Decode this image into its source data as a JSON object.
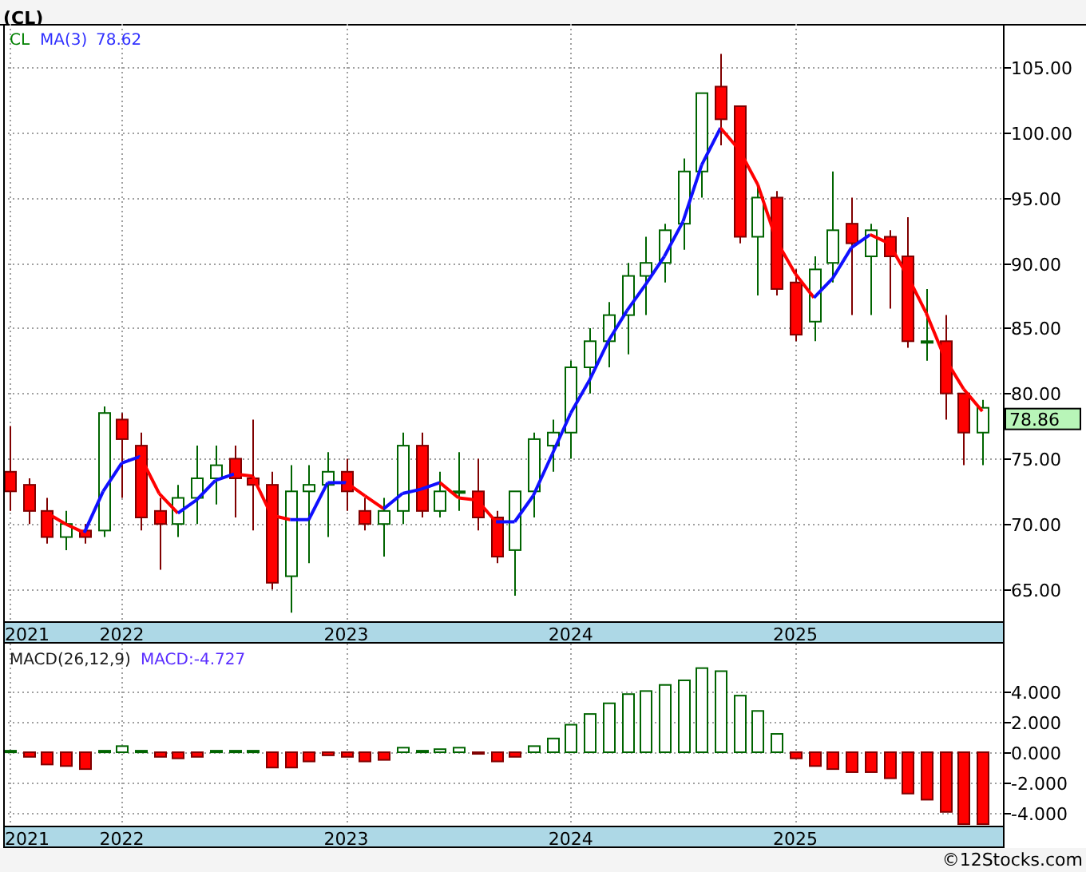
{
  "title": "(CL)",
  "price_panel": {
    "legend": {
      "symbol": "CL",
      "indicator": "MA(3)",
      "value": "78.62"
    },
    "price_tag": "78.86",
    "axis_start_label": "2021",
    "chart_data": {
      "type": "candlestick",
      "grid": true,
      "x": [
        2021.5,
        2021.583,
        2021.667,
        2021.75,
        2021.833,
        2021.917,
        2022,
        2022.083,
        2022.167,
        2022.25,
        2022.333,
        2022.417,
        2022.5,
        2022.583,
        2022.667,
        2022.75,
        2022.833,
        2022.917,
        2023,
        2023.083,
        2023.167,
        2023.25,
        2023.333,
        2023.417,
        2023.5,
        2023.583,
        2023.667,
        2023.75,
        2023.833,
        2023.917,
        2024,
        2024.083,
        2024.167,
        2024.25,
        2024.333,
        2024.417,
        2024.5,
        2024.583,
        2024.667,
        2024.75,
        2024.833,
        2024.917,
        2025,
        2025.083,
        2025.167,
        2025.25,
        2025.333,
        2025.417,
        2025.5,
        2025.583,
        2025.667,
        2025.75,
        2025.833
      ],
      "ohlc": [
        [
          74,
          77.5,
          71,
          72.5
        ],
        [
          73,
          73.5,
          70,
          71
        ],
        [
          71,
          72,
          68.5,
          69
        ],
        [
          69,
          71,
          68,
          70
        ],
        [
          69.5,
          70,
          68.5,
          69
        ],
        [
          69.5,
          79,
          69,
          78.5
        ],
        [
          78,
          78.5,
          72,
          76.5
        ],
        [
          76,
          77,
          69.5,
          70.5
        ],
        [
          71,
          72,
          66.5,
          70
        ],
        [
          70,
          73,
          69,
          72
        ],
        [
          72,
          76,
          70,
          73.5
        ],
        [
          73.5,
          76,
          71.5,
          74.5
        ],
        [
          75,
          76,
          70.5,
          73.5
        ],
        [
          73.5,
          78,
          69.5,
          73
        ],
        [
          73,
          74,
          65,
          65.5
        ],
        [
          66,
          74.5,
          63.2,
          72.5
        ],
        [
          72.5,
          74.5,
          67,
          73
        ],
        [
          73,
          75.5,
          69,
          74
        ],
        [
          74,
          75,
          71,
          72.5
        ],
        [
          71,
          72,
          69.5,
          70
        ],
        [
          70,
          72,
          67.5,
          71
        ],
        [
          71,
          77,
          70,
          76
        ],
        [
          76,
          77,
          70.5,
          71
        ],
        [
          71,
          74,
          70.5,
          72.5
        ],
        [
          72.5,
          75.5,
          71,
          72.5
        ],
        [
          72.5,
          75,
          69.5,
          70.5
        ],
        [
          70.5,
          71,
          67,
          67.5
        ],
        [
          68,
          72.5,
          64.5,
          72.5
        ],
        [
          72.5,
          77,
          70.5,
          76.5
        ],
        [
          76,
          78,
          74,
          77
        ],
        [
          77,
          82.5,
          75,
          82
        ],
        [
          82,
          85,
          80,
          84
        ],
        [
          84,
          87,
          82,
          86
        ],
        [
          86,
          90,
          83,
          89
        ],
        [
          89,
          92,
          86,
          90
        ],
        [
          90,
          93,
          88.5,
          92.5
        ],
        [
          93,
          98,
          91,
          97
        ],
        [
          97,
          103,
          95,
          103
        ],
        [
          103.5,
          106,
          99,
          101
        ],
        [
          102,
          102,
          91.5,
          92
        ],
        [
          92,
          96,
          87.5,
          95
        ],
        [
          95,
          95.5,
          87.5,
          88
        ],
        [
          88.5,
          89.5,
          84,
          84.5
        ],
        [
          85.5,
          90.5,
          84,
          89.5
        ],
        [
          90,
          97,
          88.5,
          92.5
        ],
        [
          93,
          95,
          86,
          91.5
        ],
        [
          90.5,
          93,
          86,
          92.5
        ],
        [
          92,
          92.5,
          86.5,
          90.5
        ],
        [
          90.5,
          93.5,
          83.5,
          84
        ],
        [
          84,
          88,
          82.5,
          84
        ],
        [
          84,
          86,
          78,
          80
        ],
        [
          80,
          80,
          74.5,
          77
        ],
        [
          77,
          79.5,
          74.5,
          78.9
        ]
      ],
      "xlim": [
        2021.472,
        2025.925
      ],
      "ylim": [
        62.55,
        108.3
      ],
      "yticks": [
        {
          "value": 65,
          "label": "65.00"
        },
        {
          "value": 70,
          "label": "70.00"
        },
        {
          "value": 75,
          "label": "75.00"
        },
        {
          "value": 80,
          "label": "80.00"
        },
        {
          "value": 85,
          "label": "85.00"
        },
        {
          "value": 90,
          "label": "90.00"
        },
        {
          "value": 95,
          "label": "95.00"
        },
        {
          "value": 100,
          "label": "100.00"
        },
        {
          "value": 105,
          "label": "105.00"
        }
      ],
      "xticks": [
        {
          "value": 2022,
          "label": "2022"
        },
        {
          "value": 2023,
          "label": "2023"
        },
        {
          "value": 2024,
          "label": "2024"
        },
        {
          "value": 2025,
          "label": "2025"
        }
      ]
    }
  },
  "macd_panel": {
    "legend": {
      "name": "MACD(26,12,9)",
      "value": "MACD:-4.727"
    },
    "axis_start_label": "2021",
    "chart_data": {
      "type": "bar",
      "grid": true,
      "x": [
        2021.5,
        2021.583,
        2021.667,
        2021.75,
        2021.833,
        2021.917,
        2022,
        2022.083,
        2022.167,
        2022.25,
        2022.333,
        2022.417,
        2022.5,
        2022.583,
        2022.667,
        2022.75,
        2022.833,
        2022.917,
        2023,
        2023.083,
        2023.167,
        2023.25,
        2023.333,
        2023.417,
        2023.5,
        2023.583,
        2023.667,
        2023.75,
        2023.833,
        2023.917,
        2024,
        2024.083,
        2024.167,
        2024.25,
        2024.333,
        2024.417,
        2024.5,
        2024.583,
        2024.667,
        2024.75,
        2024.833,
        2024.917,
        2025,
        2025.083,
        2025.167,
        2025.25,
        2025.333,
        2025.417,
        2025.5,
        2025.583,
        2025.667,
        2025.75,
        2025.833
      ],
      "values": [
        0.1,
        -0.3,
        -0.8,
        -0.9,
        -1.1,
        0.1,
        0.4,
        0.1,
        -0.3,
        -0.4,
        -0.3,
        0.1,
        0.1,
        0.1,
        -1.0,
        -1.0,
        -0.6,
        -0.2,
        -0.3,
        -0.6,
        -0.5,
        0.3,
        0.1,
        0.2,
        0.3,
        -0.1,
        -0.6,
        -0.3,
        0.4,
        0.9,
        1.8,
        2.5,
        3.2,
        3.8,
        4.0,
        4.4,
        4.7,
        5.5,
        5.3,
        3.7,
        2.7,
        1.2,
        -0.4,
        -0.9,
        -1.1,
        -1.3,
        -1.3,
        -1.7,
        -2.7,
        -3.1,
        -3.9,
        -4.7,
        -4.7
      ],
      "xlim": [
        2021.472,
        2025.925
      ],
      "ylim": [
        -4.8,
        7.1
      ],
      "yticks": [
        {
          "value": 4,
          "label": "4.000"
        },
        {
          "value": 2,
          "label": "2.000"
        },
        {
          "value": 0,
          "label": "0.000"
        },
        {
          "value": -2,
          "label": "-2.000"
        },
        {
          "value": -4,
          "label": "-4.000"
        }
      ],
      "xticks": [
        {
          "value": 2022,
          "label": "2022"
        },
        {
          "value": 2023,
          "label": "2023"
        },
        {
          "value": 2024,
          "label": "2024"
        },
        {
          "value": 2025,
          "label": "2025"
        }
      ]
    }
  },
  "copyright": "©12Stocks.com"
}
